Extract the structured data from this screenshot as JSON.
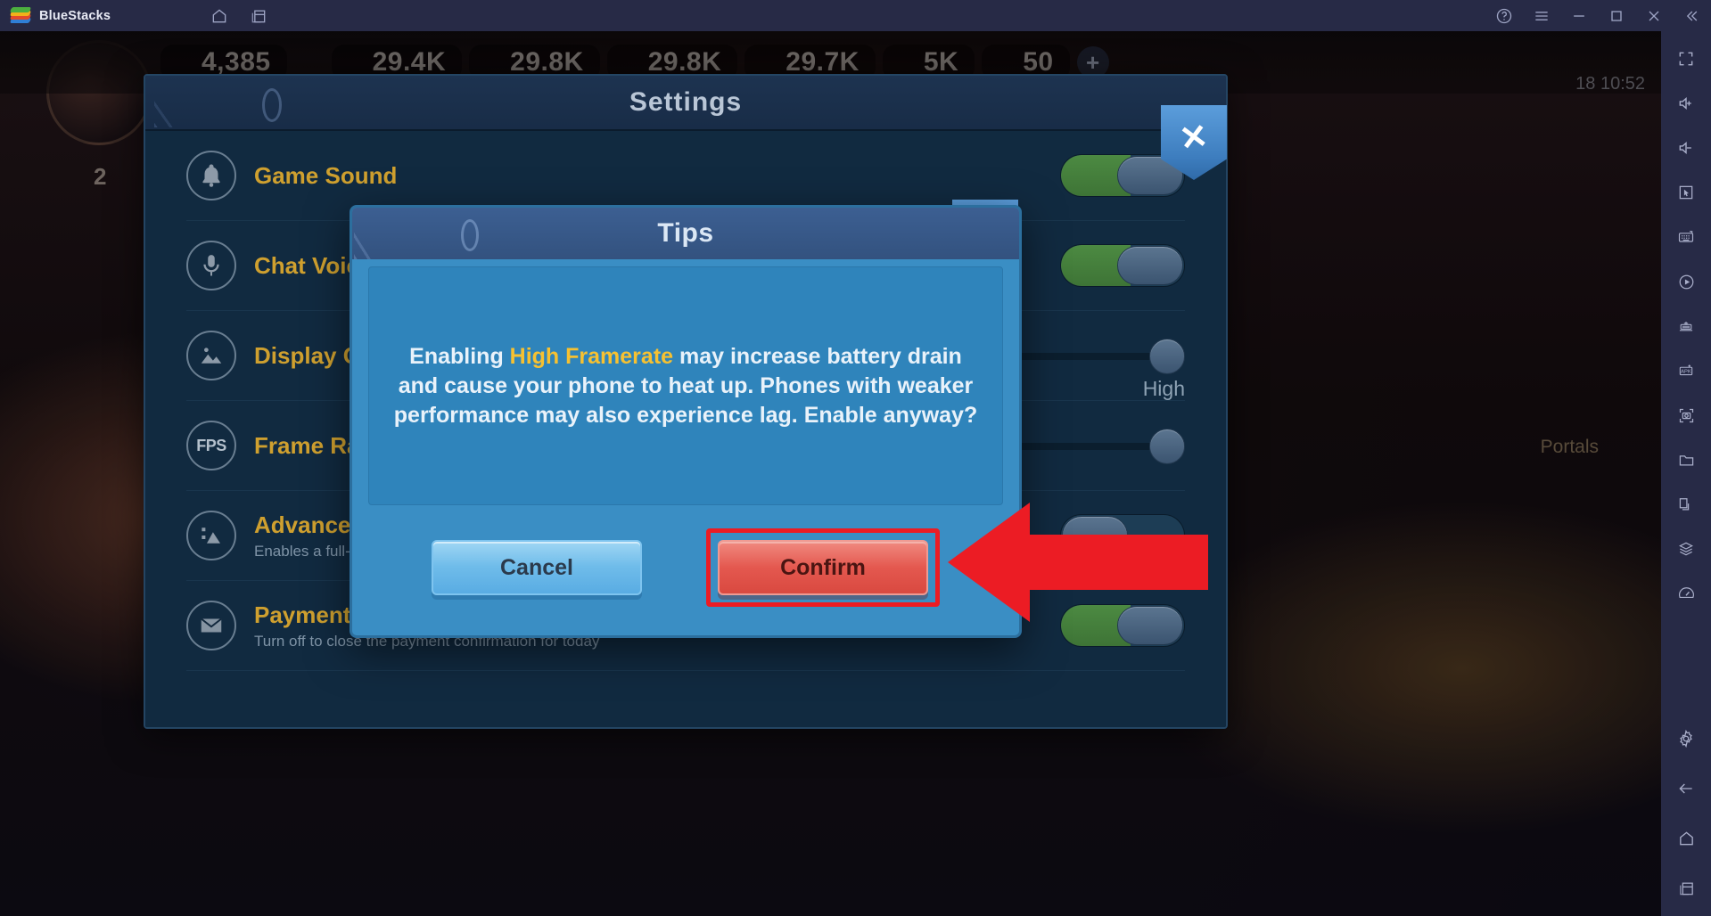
{
  "titlebar": {
    "app_name": "BlueStacks",
    "nav": [
      {
        "name": "home-icon",
        "label": "Home"
      },
      {
        "name": "multi-instance-icon",
        "label": "Multi-instance"
      }
    ],
    "controls": [
      {
        "name": "help-icon",
        "label": "Help"
      },
      {
        "name": "menu-icon",
        "label": "Menu"
      },
      {
        "name": "minimize-icon",
        "label": "Minimize"
      },
      {
        "name": "maximize-icon",
        "label": "Maximize"
      },
      {
        "name": "close-icon",
        "label": "Close"
      },
      {
        "name": "collapse-sidebar-icon",
        "label": "Collapse"
      }
    ]
  },
  "sidebar": {
    "items": [
      {
        "name": "fullscreen-icon",
        "label": "Full screen"
      },
      {
        "name": "volume-up-icon",
        "label": "Volume up"
      },
      {
        "name": "volume-down-icon",
        "label": "Volume down"
      },
      {
        "name": "cursor-icon",
        "label": "Pointer"
      },
      {
        "name": "keyboard-controls-icon",
        "label": "Game controls"
      },
      {
        "name": "macro-recorder-icon",
        "label": "Macro recorder"
      },
      {
        "name": "eco-mode-icon",
        "label": "Eco mode"
      },
      {
        "name": "install-apk-icon",
        "label": "Install APK"
      },
      {
        "name": "screenshot-icon",
        "label": "Screenshot"
      },
      {
        "name": "media-folder-icon",
        "label": "Media manager"
      },
      {
        "name": "rotate-icon",
        "label": "Rotate"
      },
      {
        "name": "multi-instance-manager-icon",
        "label": "Instance manager"
      },
      {
        "name": "performance-icon",
        "label": "Performance"
      }
    ],
    "bottom_items": [
      {
        "name": "settings-gear-icon",
        "label": "Settings"
      },
      {
        "name": "back-arrow-icon",
        "label": "Back"
      },
      {
        "name": "home-nav-icon",
        "label": "Home"
      },
      {
        "name": "recents-icon",
        "label": "Recent apps"
      }
    ]
  },
  "game_hud": {
    "power": "4,385",
    "resources": [
      "29.4K",
      "29.8K",
      "29.8K",
      "29.7K",
      "5K",
      "50"
    ],
    "plus_label": "+",
    "clock": "18 10:52",
    "player_level": "2",
    "portals_label": "Portals"
  },
  "settings_panel": {
    "title": "Settings",
    "close_icon": "x-shield-close-icon",
    "close_glyph": "✕",
    "rows": [
      {
        "icon": "bell-icon",
        "label": "Game Sound",
        "desc": "",
        "control": "toggle",
        "state": "on"
      },
      {
        "icon": "microphone-icon",
        "label": "Chat Voice",
        "desc": "",
        "control": "toggle",
        "state": "on"
      },
      {
        "icon": "image-quality-icon",
        "label": "Display Quality",
        "desc": "",
        "control": "slider",
        "value_label": "High"
      },
      {
        "icon": "fps-icon",
        "icon_text": "FPS",
        "label": "Frame Rate",
        "desc": "",
        "control": "slider",
        "value_label": ""
      },
      {
        "icon": "advanced-graphics-icon",
        "label": "Advanced Graphics",
        "desc": "Enables a full-screen high-definition display",
        "control": "toggle",
        "state": "off"
      },
      {
        "icon": "envelope-icon",
        "label": "Payment Confirmation",
        "desc": "Turn off to close the payment confirmation for today",
        "control": "toggle",
        "state": "on"
      }
    ]
  },
  "tips_dialog": {
    "title": "Tips",
    "close_icon": "x-shield-close-icon",
    "close_glyph": "✕",
    "message_parts": [
      {
        "text": "Enabling ",
        "highlight": false
      },
      {
        "text": "High Framerate",
        "highlight": true
      },
      {
        "text": " may increase battery drain and cause your phone to heat up. Phones with weaker performance may also experience lag. Enable anyway?",
        "highlight": false
      }
    ],
    "message_plain": "Enabling High Framerate may increase battery drain and cause your phone to heat up. Phones with weaker performance may also experience lag. Enable anyway?",
    "cancel_label": "Cancel",
    "confirm_label": "Confirm"
  },
  "annotation": {
    "arrow_name": "red-pointer-arrow",
    "highlight_target": "Confirm",
    "color": "#ec1c24"
  },
  "colors": {
    "accent_gold": "#cfa02f",
    "dialog_blue": "#3a8ec4",
    "confirm_red": "#e4584f",
    "highlight_red": "#ec1c24",
    "toggle_green": "#4c8a42",
    "titlebar": "#272a46"
  }
}
